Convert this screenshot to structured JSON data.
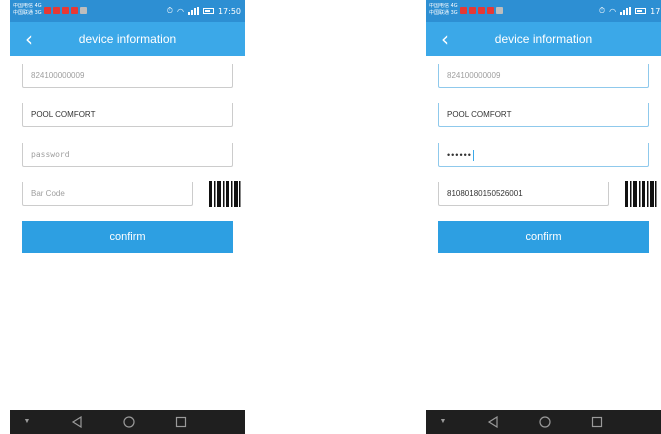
{
  "status_bar": {
    "carrier_text": "中国电信 4G 中国联通 3G",
    "time_left": "17:50",
    "time_right": "17:"
  },
  "app_bar": {
    "back_glyph": "‹",
    "title": "device information"
  },
  "left_screen": {
    "device_id": "824100000009",
    "device_name": "POOL COMFORT",
    "password_placeholder": "password",
    "barcode_placeholder": "Bar Code",
    "confirm_label": "confirm"
  },
  "right_screen": {
    "device_id": "824100000009",
    "device_name": "POOL COMFORT",
    "password_masked": "••••••",
    "barcode_value": "81080180150526001",
    "confirm_label": "confirm"
  },
  "icons": {
    "back": "chevron-left-icon",
    "barcode": "barcode-scan-icon",
    "nav_down": "chevron-down-icon",
    "nav_back": "triangle-back-icon",
    "nav_home": "circle-home-icon",
    "nav_recent": "square-recent-icon"
  },
  "colors": {
    "status_bar": "#2d8fd3",
    "app_bar": "#3ba8e8",
    "confirm_button": "#2d9fe2",
    "nav_bar": "#1f1f1f"
  }
}
